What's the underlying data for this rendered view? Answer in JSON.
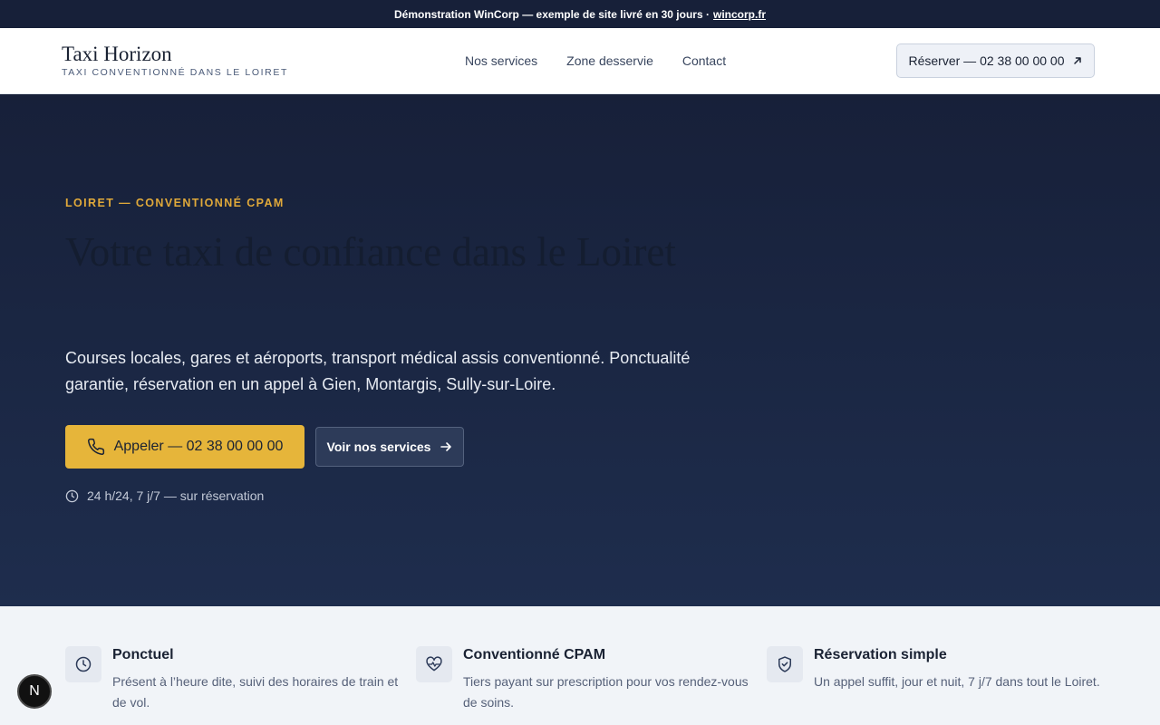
{
  "banner": {
    "text": "Démonstration WinCorp — exemple de site livré en 30 jours ·",
    "link": "wincorp.fr"
  },
  "header": {
    "brand_name": "Taxi Horizon",
    "brand_tagline": "TAXI CONVENTIONNÉ DANS LE LOIRET",
    "nav": [
      "Nos services",
      "Zone desservie",
      "Contact"
    ],
    "book_button": "Réserver — 02 38 00 00 00"
  },
  "hero": {
    "eyebrow": "LOIRET — CONVENTIONNÉ CPAM",
    "title": "Votre taxi de confiance dans le Loiret",
    "subtitle": "Courses locales, gares et aéroports, transport médical assis conventionné. Ponctualité garantie, réservation en un appel à Gien, Montargis, Sully-sur-Loire.",
    "call_button": "Appeler — 02 38 00 00 00",
    "services_button": "Voir nos services",
    "hours": "24 h/24, 7 j/7 — sur réservation"
  },
  "features": [
    {
      "icon": "clock-icon",
      "title": "Ponctuel",
      "description": "Présent à l’heure dite, suivi des horaires de train et de vol."
    },
    {
      "icon": "heart-pulse-icon",
      "title": "Conventionné CPAM",
      "description": "Tiers payant sur prescription pour vos rendez-vous de soins."
    },
    {
      "icon": "shield-check-icon",
      "title": "Réservation simple",
      "description": "Un appel suffit, jour et nuit, 7 j/7 dans tout le Loiret."
    }
  ],
  "dev_badge": "N",
  "colors": {
    "navy": "#172039",
    "accent": "#e6b53a",
    "eyebrow": "#e0a93a"
  }
}
